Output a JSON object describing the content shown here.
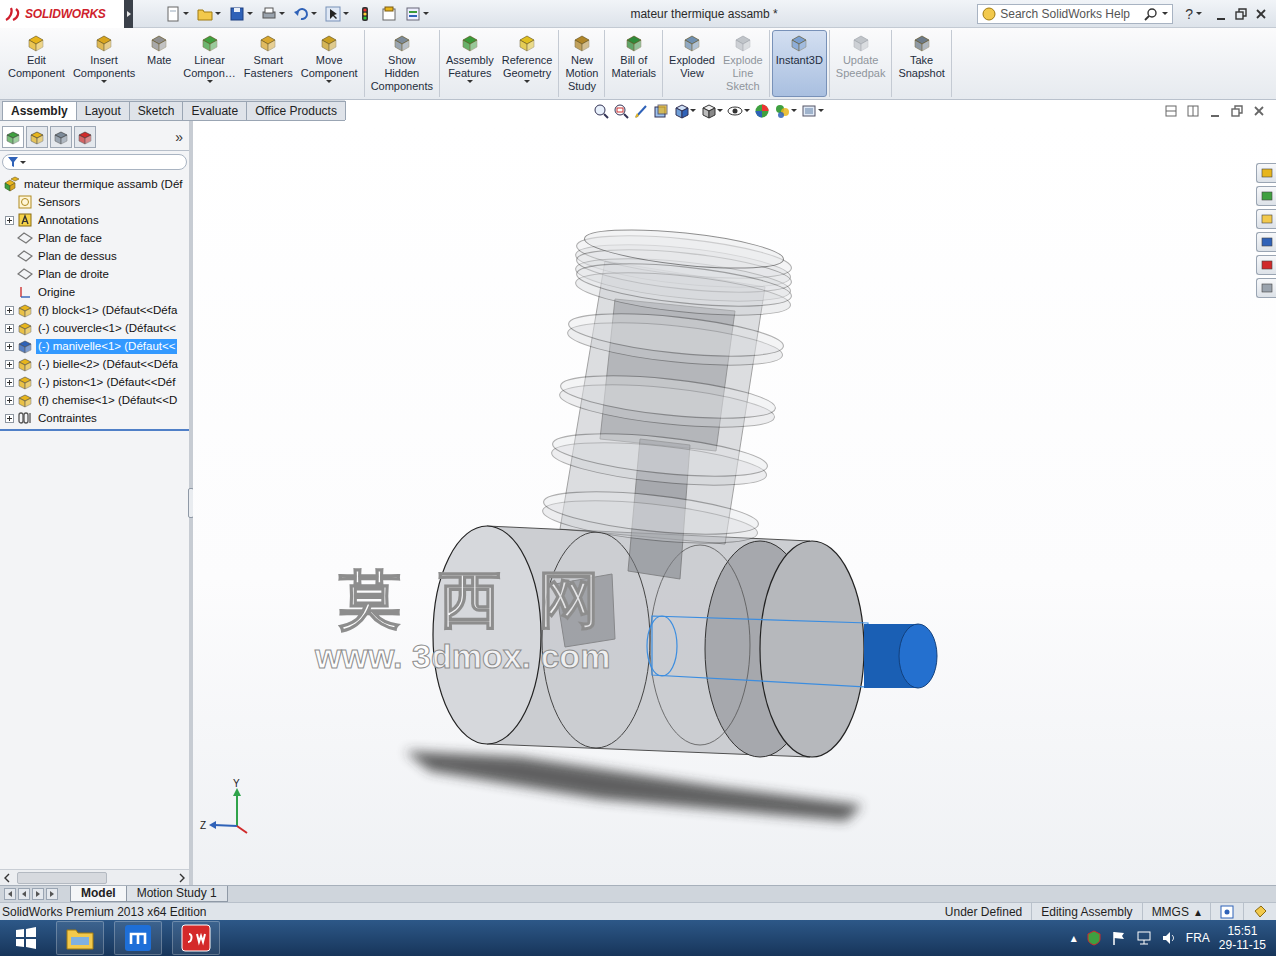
{
  "app": {
    "logo": "SOLIDWORKS"
  },
  "window": {
    "title": "mateur thermique assamb *",
    "help": "?"
  },
  "search": {
    "placeholder": "Search SolidWorks Help"
  },
  "ribbon": [
    [
      {
        "lines": [
          "Edit",
          "Component"
        ],
        "dropdown": false,
        "disabled": false,
        "selected": false
      },
      {
        "lines": [
          "Insert",
          "Components"
        ],
        "dropdown": true,
        "disabled": false,
        "selected": false
      },
      {
        "lines": [
          "Mate"
        ],
        "dropdown": false,
        "disabled": false,
        "selected": false
      },
      {
        "lines": [
          "Linear",
          "Compon…"
        ],
        "dropdown": true,
        "disabled": false,
        "selected": false
      },
      {
        "lines": [
          "Smart",
          "Fasteners"
        ],
        "dropdown": false,
        "disabled": false,
        "selected": false
      },
      {
        "lines": [
          "Move",
          "Component"
        ],
        "dropdown": true,
        "disabled": false,
        "selected": false
      }
    ],
    [
      {
        "lines": [
          "Show",
          "Hidden",
          "Components"
        ],
        "dropdown": false,
        "disabled": false,
        "selected": false
      }
    ],
    [
      {
        "lines": [
          "Assembly",
          "Features"
        ],
        "dropdown": true,
        "disabled": false,
        "selected": false
      },
      {
        "lines": [
          "Reference",
          "Geometry"
        ],
        "dropdown": true,
        "disabled": false,
        "selected": false
      }
    ],
    [
      {
        "lines": [
          "New",
          "Motion",
          "Study"
        ],
        "dropdown": false,
        "disabled": false,
        "selected": false
      }
    ],
    [
      {
        "lines": [
          "Bill of",
          "Materials"
        ],
        "dropdown": false,
        "disabled": false,
        "selected": false
      }
    ],
    [
      {
        "lines": [
          "Exploded",
          "View"
        ],
        "dropdown": false,
        "disabled": false,
        "selected": false
      },
      {
        "lines": [
          "Explode",
          "Line",
          "Sketch"
        ],
        "dropdown": false,
        "disabled": true,
        "selected": false
      }
    ],
    [
      {
        "lines": [
          "Instant3D"
        ],
        "dropdown": false,
        "disabled": false,
        "selected": true
      }
    ],
    [
      {
        "lines": [
          "Update",
          "Speedpak"
        ],
        "dropdown": false,
        "disabled": true,
        "selected": false
      }
    ],
    [
      {
        "lines": [
          "Take",
          "Snapshot"
        ],
        "dropdown": false,
        "disabled": false,
        "selected": false
      }
    ]
  ],
  "command_tabs": [
    {
      "label": "Assembly",
      "selected": true
    },
    {
      "label": "Layout",
      "selected": false
    },
    {
      "label": "Sketch",
      "selected": false
    },
    {
      "label": "Evaluate",
      "selected": false
    },
    {
      "label": "Office Products",
      "selected": false
    }
  ],
  "feature_manager": {
    "more": "»",
    "items": [
      {
        "label": "mateur thermique assamb (Déf",
        "kind": "assembly",
        "depth": 0,
        "expandable": false,
        "selected": false
      },
      {
        "label": "Sensors",
        "kind": "sensor",
        "depth": 1,
        "expandable": false,
        "selected": false
      },
      {
        "label": "Annotations",
        "kind": "annotation",
        "depth": 1,
        "expandable": true,
        "selected": false
      },
      {
        "label": "Plan de face",
        "kind": "plane",
        "depth": 1,
        "expandable": false,
        "selected": false
      },
      {
        "label": "Plan de dessus",
        "kind": "plane",
        "depth": 1,
        "expandable": false,
        "selected": false
      },
      {
        "label": "Plan de droite",
        "kind": "plane",
        "depth": 1,
        "expandable": false,
        "selected": false
      },
      {
        "label": "Origine",
        "kind": "origin",
        "depth": 1,
        "expandable": false,
        "selected": false
      },
      {
        "label": "(f) block<1> (Défaut<<Défa",
        "kind": "part",
        "depth": 1,
        "expandable": true,
        "selected": false
      },
      {
        "label": "(-) couvercle<1> (Défaut<<",
        "kind": "part",
        "depth": 1,
        "expandable": true,
        "selected": false
      },
      {
        "label": "(-) manivelle<1> (Défaut<<",
        "kind": "part",
        "depth": 1,
        "expandable": true,
        "selected": true
      },
      {
        "label": "(-) bielle<2> (Défaut<<Défa",
        "kind": "part",
        "depth": 1,
        "expandable": true,
        "selected": false
      },
      {
        "label": "(-) piston<1> (Défaut<<Déf",
        "kind": "part",
        "depth": 1,
        "expandable": true,
        "selected": false
      },
      {
        "label": "(f) chemise<1> (Défaut<<D",
        "kind": "part",
        "depth": 1,
        "expandable": true,
        "selected": false
      },
      {
        "label": "Contraintes",
        "kind": "mates",
        "depth": 1,
        "expandable": true,
        "selected": false
      }
    ]
  },
  "viewport": {
    "watermark": {
      "title": "莫 西 网",
      "url": "www. 3dmox. com"
    },
    "triad": {
      "y": "Y",
      "z": "Z"
    }
  },
  "bottom_tabs": [
    {
      "label": "Model",
      "selected": true
    },
    {
      "label": "Motion Study 1",
      "selected": false
    }
  ],
  "status_bar": {
    "edition": "SolidWorks Premium 2013 x64 Edition",
    "state": "Under Defined",
    "mode": "Editing Assembly",
    "units": "MMGS",
    "units_arrow": "▴"
  },
  "taskbar": {
    "tray_arrow": "▴",
    "language": "FRA",
    "time": "15:51",
    "date": "29-11-15"
  }
}
